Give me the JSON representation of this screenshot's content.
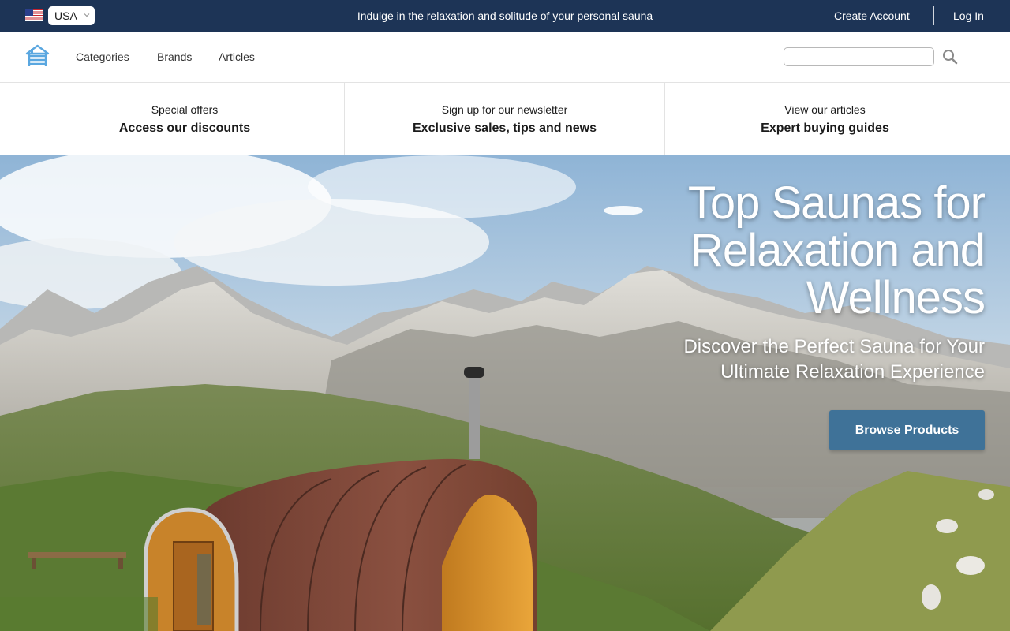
{
  "topbar": {
    "country": "USA",
    "announcement": "Indulge in the relaxation and solitude of your personal sauna",
    "create_account": "Create Account",
    "login": "Log In"
  },
  "nav": {
    "links": [
      "Categories",
      "Brands",
      "Articles"
    ],
    "search_placeholder": ""
  },
  "promos": [
    {
      "small": "Special offers",
      "big": "Access our discounts"
    },
    {
      "small": "Sign up for our newsletter",
      "big": "Exclusive sales, tips and news"
    },
    {
      "small": "View our articles",
      "big": "Expert buying guides"
    }
  ],
  "hero": {
    "title": "Top Saunas for Relaxation and Wellness",
    "subtitle": "Discover the Perfect Sauna for Your Ultimate Relaxation Experience",
    "cta": "Browse Products"
  },
  "icons": {
    "flag": "us-flag-icon",
    "chevron": "chevron-down-icon",
    "logo": "house-logo-icon",
    "search": "search-icon"
  },
  "colors": {
    "topbar_bg": "#1d3456",
    "accent_button": "#3f7298",
    "logo_blue": "#5aa7e0"
  }
}
